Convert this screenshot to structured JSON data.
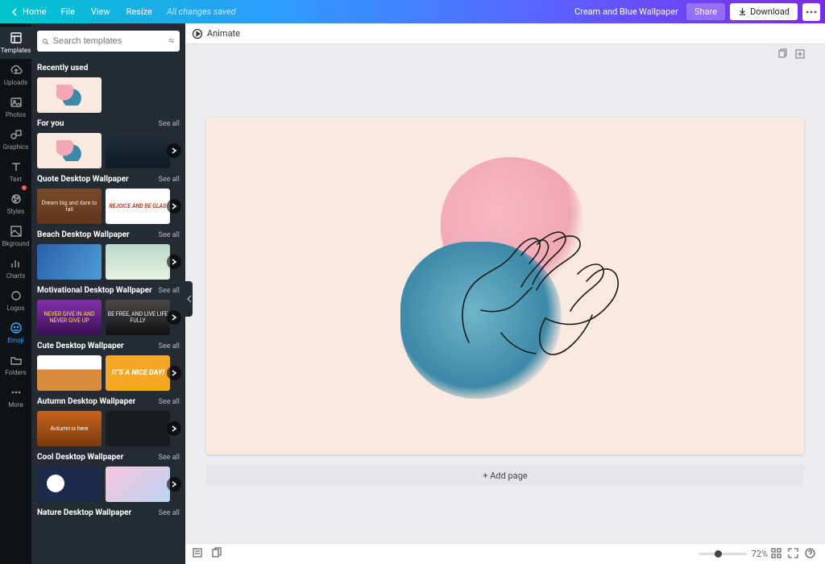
{
  "topbar": {
    "home": "Home",
    "menus": [
      "File",
      "View",
      "Resize"
    ],
    "saved": "All changes saved",
    "doc_name": "Cream and Blue Wallpaper",
    "share": "Share",
    "download": "Download"
  },
  "nav": [
    {
      "id": "templates",
      "label": "Templates"
    },
    {
      "id": "uploads",
      "label": "Uploads"
    },
    {
      "id": "photos",
      "label": "Photos"
    },
    {
      "id": "graphics",
      "label": "Graphics"
    },
    {
      "id": "text",
      "label": "Text"
    },
    {
      "id": "styles",
      "label": "Styles"
    },
    {
      "id": "bkground",
      "label": "Bkground"
    },
    {
      "id": "charts",
      "label": "Charts"
    },
    {
      "id": "logos",
      "label": "Logos"
    },
    {
      "id": "emoji",
      "label": "Emoji"
    },
    {
      "id": "folders",
      "label": "Folders"
    },
    {
      "id": "more",
      "label": "More"
    }
  ],
  "search": {
    "placeholder": "Search templates"
  },
  "panel": {
    "see_all": "See all",
    "recent_title": "Recently used",
    "sections": [
      {
        "title": "For you"
      },
      {
        "title": "Quote Desktop Wallpaper"
      },
      {
        "title": "Beach Desktop Wallpaper"
      },
      {
        "title": "Motivational Desktop Wallpaper"
      },
      {
        "title": "Cute Desktop Wallpaper"
      },
      {
        "title": "Autumn Desktop Wallpaper"
      },
      {
        "title": "Cool Desktop Wallpaper"
      },
      {
        "title": "Nature Desktop Wallpaper"
      }
    ],
    "thumbs": {
      "quote_1": "Dream big and dare to fail",
      "quote_2": "REJOICE AND BE GLAD",
      "motiv_1": "NEVER GIVE IN AND NEVER GIVE UP",
      "motiv_2": "BE FREE, AND LIVE LIFE FULLY",
      "cute_2": "IT'S A NICE DAY!",
      "autumn_1": "Autumn is here"
    }
  },
  "toolbar": {
    "animate": "Animate"
  },
  "canvas": {
    "add_page": "+ Add page"
  },
  "status": {
    "zoom": "72%"
  }
}
